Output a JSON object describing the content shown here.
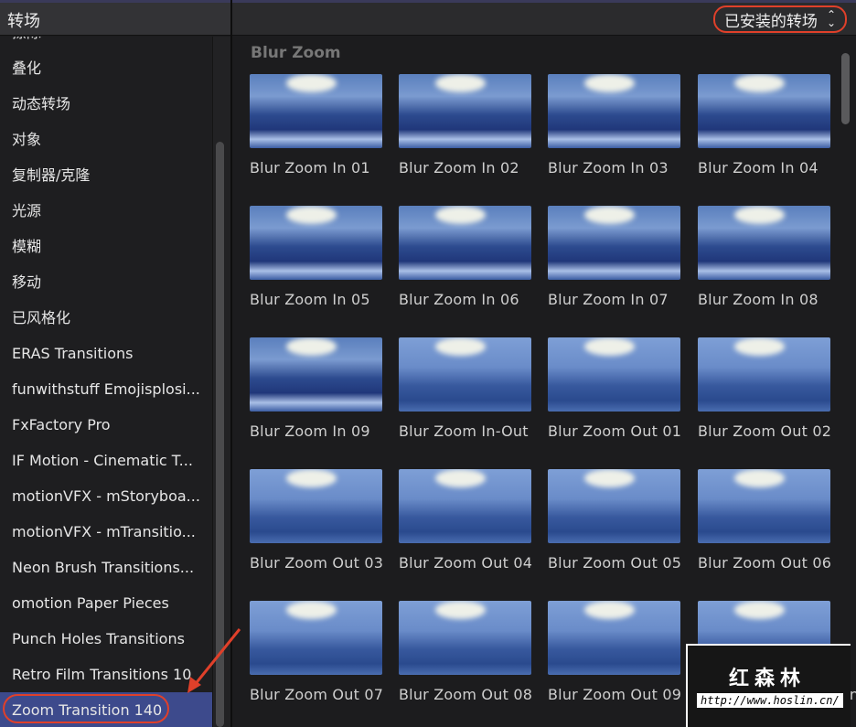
{
  "sidebar": {
    "title": "转场",
    "items": [
      "擦除",
      "叠化",
      "动态转场",
      "对象",
      "复制器/克隆",
      "光源",
      "模糊",
      "移动",
      "已风格化",
      "ERAS Transitions",
      "funwithstuff Emojisplosi...",
      "FxFactory Pro",
      "IF Motion - Cinematic T...",
      "motionVFX - mStoryboa...",
      "motionVFX - mTransitio...",
      "Neon Brush Transitions...",
      "omotion Paper Pieces",
      "Punch Holes Transitions",
      "Retro Film Transitions 10",
      "Zoom Transition 140"
    ],
    "selected": "Zoom Transition 140"
  },
  "header": {
    "dropdown": "已安装的转场",
    "dropdown_icon": "chevron-updown-icon"
  },
  "main": {
    "section": "Blur Zoom",
    "tiles": [
      "Blur Zoom In 01",
      "Blur Zoom In 02",
      "Blur Zoom In 03",
      "Blur Zoom In 04",
      "Blur Zoom In 05",
      "Blur Zoom In 06",
      "Blur Zoom In 07",
      "Blur Zoom In 08",
      "Blur Zoom In 09",
      "Blur Zoom In-Out",
      "Blur Zoom Out 01",
      "Blur Zoom Out 02",
      "Blur Zoom Out 03",
      "Blur Zoom Out 04",
      "Blur Zoom Out 05",
      "Blur Zoom Out 06",
      "Blur Zoom Out 07",
      "Blur Zoom Out 08",
      "Blur Zoom Out 09",
      "Blur Zoom Out Out-In"
    ]
  },
  "watermark": {
    "name": "红森林",
    "url": "http://www.hoslin.cn/"
  },
  "colors": {
    "accent": "#e0402a",
    "selection": "#3d4a8c"
  }
}
